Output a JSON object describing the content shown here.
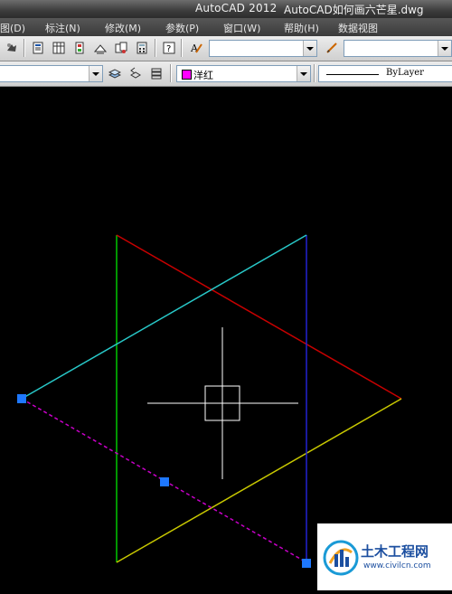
{
  "title_bar": {
    "app_name": "AutoCAD 2012",
    "document_name": "AutoCAD如何画六芒星.dwg"
  },
  "menu": {
    "items": [
      "图(D)",
      "标注(N)",
      "修改(M)",
      "参数(P)",
      "窗口(W)",
      "帮助(H)",
      "数据视图"
    ]
  },
  "properties_bar": {
    "color_value": "洋红",
    "color_hex": "#ff00ff",
    "linetype_value": "ByLayer"
  },
  "drawing": {
    "background": "#000000",
    "line_colors": {
      "green": "#00c800",
      "red": "#c80000",
      "blue": "#2323d2",
      "cyan": "#28c8c8",
      "yellow": "#c8c800",
      "magenta_dashed": "#c800c8"
    },
    "grip_color": "#1e78ff",
    "crosshair_color": "#ffffff"
  },
  "watermark": {
    "title": "土木工程网",
    "url": "www.civilcn.com"
  }
}
